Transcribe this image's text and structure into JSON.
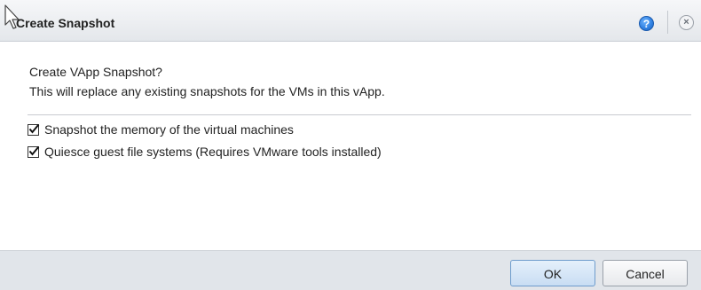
{
  "dialog": {
    "title": "Create Snapshot",
    "help_icon": "question-mark-icon",
    "close_icon": "close-icon",
    "help_glyph": "?",
    "close_glyph": "×"
  },
  "body": {
    "question": "Create VApp Snapshot?",
    "description": "This will replace any existing snapshots for the VMs in this vApp."
  },
  "options": [
    {
      "label": "Snapshot the memory of the virtual machines",
      "checked": true
    },
    {
      "label": "Quiesce guest file systems (Requires VMware tools installed)",
      "checked": true
    }
  ],
  "buttons": {
    "ok_label": "OK",
    "cancel_label": "Cancel"
  },
  "colors": {
    "titlebar": "#e4e7eb",
    "footer": "#e1e5ea",
    "accent": "#2f7fe0"
  }
}
